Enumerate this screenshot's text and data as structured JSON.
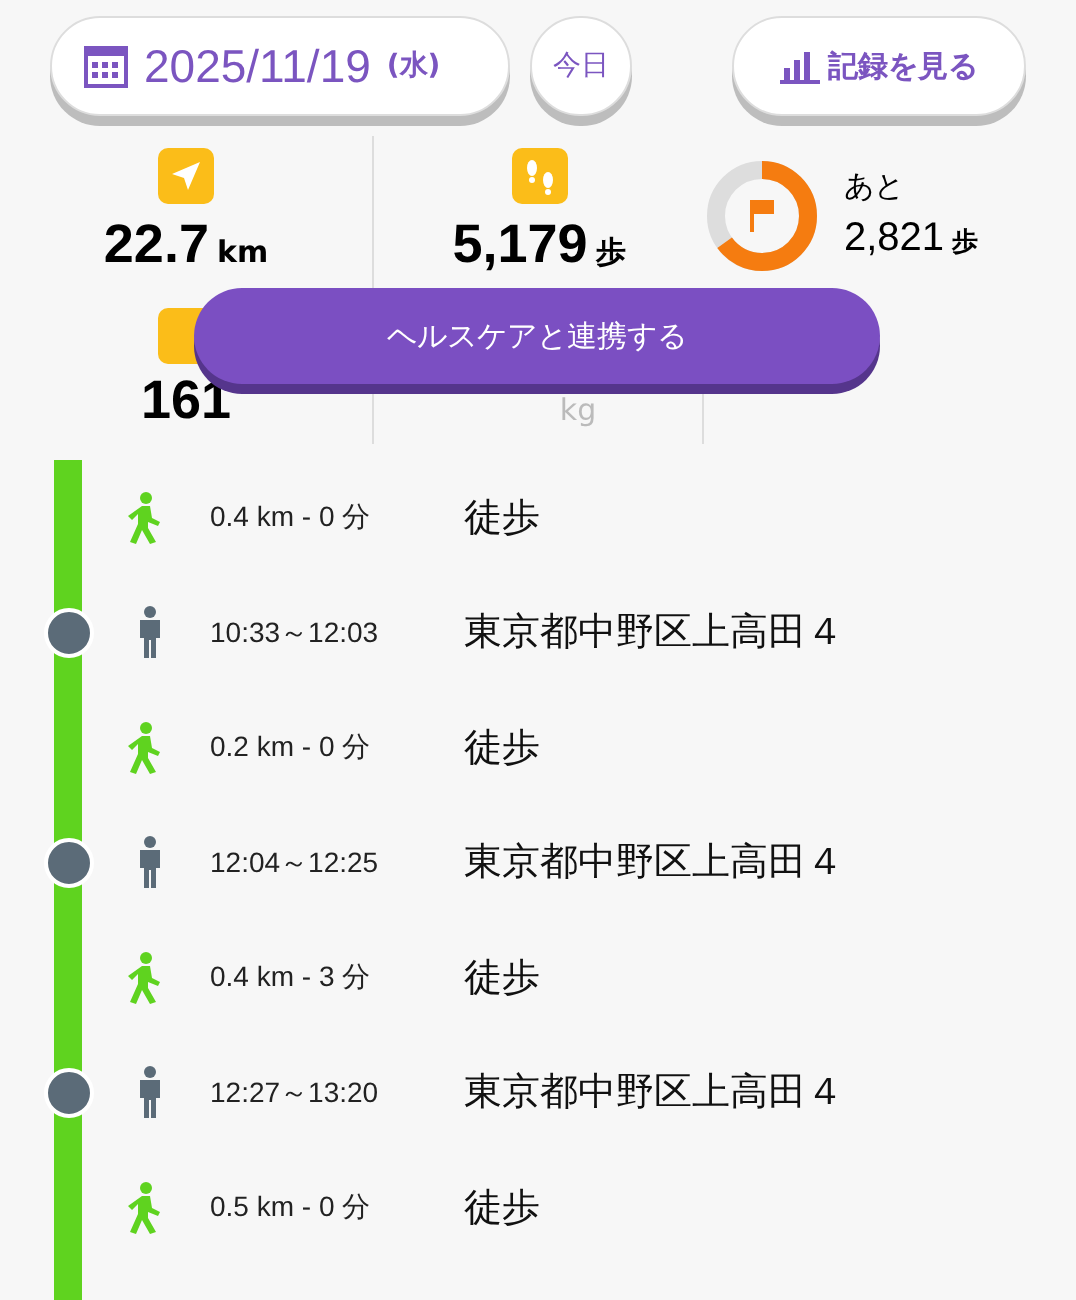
{
  "header": {
    "date": "2025/11/19",
    "weekday": "(水)",
    "today_button": "今日",
    "records_button": "記録を見る"
  },
  "stats": {
    "distance": {
      "value": "22.7",
      "unit": "km"
    },
    "steps": {
      "value": "5,179",
      "unit": "歩"
    },
    "goal": {
      "label": "あと",
      "value": "2,821",
      "unit": "歩",
      "level": 0.65
    }
  },
  "stats_row_2": {
    "calories": {
      "value": "161"
    },
    "weight": {
      "unit": "kg"
    }
  },
  "health_button": "ヘルスケアと連携する",
  "timeline": [
    {
      "kind": "walk",
      "detail": "0.4 km - 0 分",
      "label": "徒歩"
    },
    {
      "kind": "stay",
      "detail": "10:33～12:03",
      "label": "東京都中野区上高田４"
    },
    {
      "kind": "walk",
      "detail": "0.2 km - 0 分",
      "label": "徒歩"
    },
    {
      "kind": "stay",
      "detail": "12:04～12:25",
      "label": "東京都中野区上高田４"
    },
    {
      "kind": "walk",
      "detail": "0.4 km - 3 分",
      "label": "徒歩"
    },
    {
      "kind": "stay",
      "detail": "12:27～13:20",
      "label": "東京都中野区上高田４"
    },
    {
      "kind": "walk",
      "detail": "0.5 km - 0 分",
      "label": "徒歩"
    }
  ]
}
